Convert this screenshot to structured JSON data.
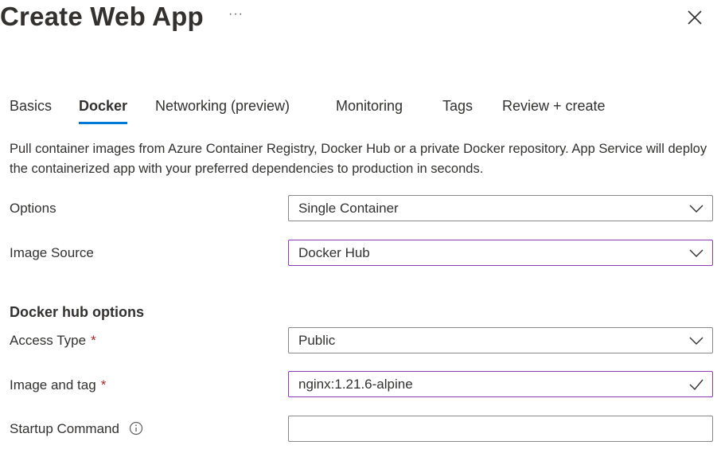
{
  "header": {
    "title": "Create Web App",
    "more_label": "···"
  },
  "tabs": [
    {
      "label": "Basics",
      "active": false
    },
    {
      "label": "Docker",
      "active": true
    },
    {
      "label": "Networking (preview)",
      "active": false
    },
    {
      "label": "Monitoring",
      "active": false
    },
    {
      "label": "Tags",
      "active": false
    },
    {
      "label": "Review + create",
      "active": false
    }
  ],
  "description": "Pull container images from Azure Container Registry, Docker Hub or a private Docker repository. App Service will deploy the containerized app with your preferred dependencies to production in seconds.",
  "form": {
    "options": {
      "label": "Options",
      "value": "Single Container"
    },
    "image_source": {
      "label": "Image Source",
      "value": "Docker Hub"
    },
    "docker_hub_section": "Docker hub options",
    "access_type": {
      "label": "Access Type",
      "required_mark": "*",
      "value": "Public"
    },
    "image_and_tag": {
      "label": "Image and tag",
      "required_mark": "*",
      "value": "nginx:1.21.6-alpine"
    },
    "startup_command": {
      "label": "Startup Command",
      "value": ""
    }
  },
  "colors": {
    "accent": "#0078d4",
    "focus_border": "#8a3ab9",
    "required": "#a4262c",
    "text": "#323130"
  },
  "icons": {
    "close": "close-icon",
    "more": "more-icon",
    "dropdown": "chevron-down-icon",
    "valid": "checkmark-icon",
    "info": "info-icon"
  }
}
